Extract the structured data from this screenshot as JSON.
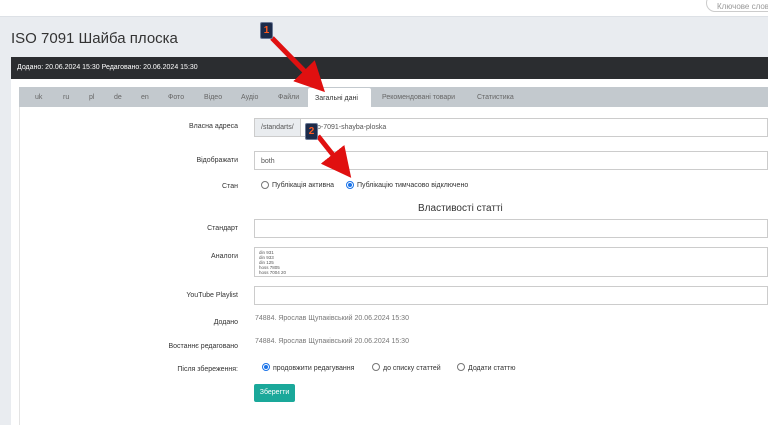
{
  "search": {
    "placeholder": "Ключове слово і"
  },
  "page": {
    "title": "ISO 7091 Шайба плоска"
  },
  "meta": {
    "text": "Додано: 20.06.2024 15:30 Редаговано: 20.06.2024 15:30"
  },
  "tabs": [
    {
      "label": "uk"
    },
    {
      "label": "ru"
    },
    {
      "label": "pl"
    },
    {
      "label": "de"
    },
    {
      "label": "en"
    },
    {
      "label": "Фото"
    },
    {
      "label": "Відео"
    },
    {
      "label": "Аудіо"
    },
    {
      "label": "Файли"
    },
    {
      "label": "Загальні дані"
    },
    {
      "label": "Рекомендовані товари"
    },
    {
      "label": "Статистика"
    }
  ],
  "active_tab": "Загальні дані",
  "form": {
    "url_label": "Власна адреса",
    "url_prefix": "/standarts/",
    "url_value": "p-7091-shayba-ploska",
    "display_label": "Відображати",
    "display_value": "both",
    "state_label": "Стан",
    "state_options": [
      "Публікація активна",
      "Публікацію тимчасово відключено"
    ],
    "state_selected": "Публікацію тимчасово відключено",
    "properties_title": "Властивості статті",
    "standard_label": "Стандарт",
    "analogs_label": "Аналоги",
    "analogs_lines": [
      "din 931",
      "din 933",
      "din 125",
      "hoss 7805",
      "hoss 7004 20"
    ],
    "youtube_label": "YouTube Playlist",
    "added_label": "Додано",
    "added_value": "74884. Ярослав Щупаківський 20.06.2024 15:30",
    "edited_label": "Востаннє редаговано",
    "edited_value": "74884. Ярослав Щупаківський 20.06.2024 15:30",
    "after_save_label": "Після збереження:",
    "after_save_options": [
      "продовжити редагування",
      "до списку статтей",
      "Додати статтю"
    ],
    "after_save_selected": "продовжити редагування",
    "save_button": "Зберегти"
  },
  "annotations": {
    "marker1": "1",
    "marker2": "2",
    "arrow_color": "#e01010"
  }
}
